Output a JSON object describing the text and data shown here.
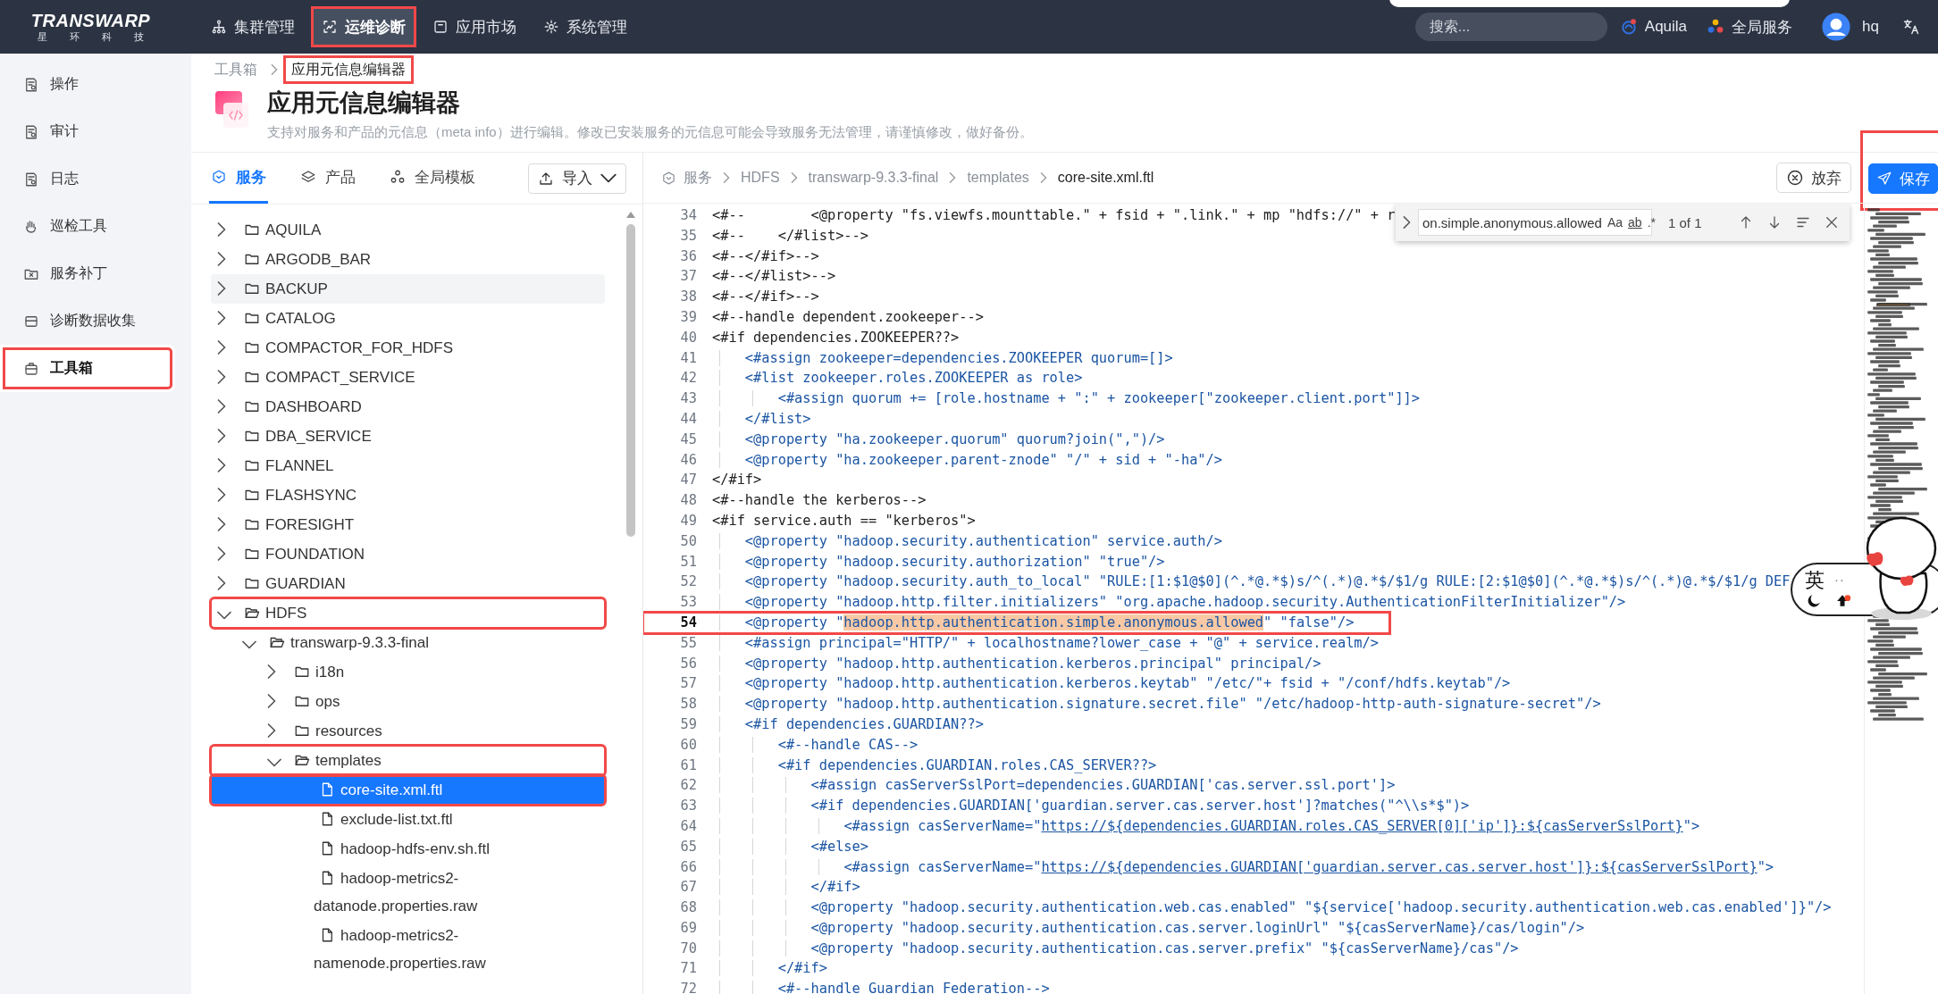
{
  "topbar": {
    "logo": {
      "name": "TRANSWARP",
      "tagline": "星 环 科 技"
    },
    "nav": [
      {
        "label": "集群管理",
        "selected": false,
        "annotated": false
      },
      {
        "label": "运维诊断",
        "selected": true,
        "annotated": true
      },
      {
        "label": "应用市场",
        "selected": false,
        "annotated": false
      },
      {
        "label": "系统管理",
        "selected": false,
        "annotated": false
      }
    ],
    "search": {
      "placeholder": "搜索..."
    },
    "links": [
      {
        "label": "Aquila"
      },
      {
        "label": "全局服务"
      }
    ],
    "user": {
      "name": "hq"
    }
  },
  "sidebar": {
    "items": [
      {
        "label": "操作",
        "selected": false,
        "annotated": false
      },
      {
        "label": "审计",
        "selected": false,
        "annotated": false
      },
      {
        "label": "日志",
        "selected": false,
        "annotated": false
      },
      {
        "label": "巡检工具",
        "selected": false,
        "annotated": false
      },
      {
        "label": "服务补丁",
        "selected": false,
        "annotated": false
      },
      {
        "label": "诊断数据收集",
        "selected": false,
        "annotated": false
      },
      {
        "label": "工具箱",
        "selected": true,
        "annotated": true
      }
    ]
  },
  "breadcrumb": [
    {
      "label": "工具箱",
      "current": false,
      "annotated": false
    },
    {
      "label": "应用元信息编辑器",
      "current": true,
      "annotated": true
    }
  ],
  "page": {
    "title": "应用元信息编辑器",
    "description": "支持对服务和产品的元信息（meta info）进行编辑。修改已安装服务的元信息可能会导致服务无法管理，请谨慎修改，做好备份。"
  },
  "tree_panel": {
    "tabs": [
      {
        "label": "服务",
        "selected": true
      },
      {
        "label": "产品",
        "selected": false
      },
      {
        "label": "全局模板",
        "selected": false
      }
    ],
    "import_button": "导入",
    "tree": [
      {
        "kind": "folder",
        "name": "AQUILA",
        "expanded": false,
        "selected": false,
        "hovered": false,
        "annotated": false
      },
      {
        "kind": "folder",
        "name": "ARGODB_BAR",
        "expanded": false,
        "selected": false,
        "hovered": false,
        "annotated": false
      },
      {
        "kind": "folder",
        "name": "BACKUP",
        "expanded": false,
        "selected": false,
        "hovered": true,
        "annotated": false
      },
      {
        "kind": "folder",
        "name": "CATALOG",
        "expanded": false,
        "selected": false,
        "hovered": false,
        "annotated": false
      },
      {
        "kind": "folder",
        "name": "COMPACTOR_FOR_HDFS",
        "expanded": false,
        "selected": false,
        "hovered": false,
        "annotated": false
      },
      {
        "kind": "folder",
        "name": "COMPACT_SERVICE",
        "expanded": false,
        "selected": false,
        "hovered": false,
        "annotated": false
      },
      {
        "kind": "folder",
        "name": "DASHBOARD",
        "expanded": false,
        "selected": false,
        "hovered": false,
        "annotated": false
      },
      {
        "kind": "folder",
        "name": "DBA_SERVICE",
        "expanded": false,
        "selected": false,
        "hovered": false,
        "annotated": false
      },
      {
        "kind": "folder",
        "name": "FLANNEL",
        "expanded": false,
        "selected": false,
        "hovered": false,
        "annotated": false
      },
      {
        "kind": "folder",
        "name": "FLASHSYNC",
        "expanded": false,
        "selected": false,
        "hovered": false,
        "annotated": false
      },
      {
        "kind": "folder",
        "name": "FORESIGHT",
        "expanded": false,
        "selected": false,
        "hovered": false,
        "annotated": false
      },
      {
        "kind": "folder",
        "name": "FOUNDATION",
        "expanded": false,
        "selected": false,
        "hovered": false,
        "annotated": false
      },
      {
        "kind": "folder",
        "name": "GUARDIAN",
        "expanded": false,
        "selected": false,
        "hovered": false,
        "annotated": false
      },
      {
        "kind": "folder",
        "name": "HDFS",
        "expanded": true,
        "selected": false,
        "hovered": false,
        "annotated": true,
        "children": [
          {
            "kind": "folder",
            "name": "transwarp-9.3.3-final",
            "expanded": true,
            "selected": false,
            "hovered": false,
            "annotated": false,
            "children": [
              {
                "kind": "folder",
                "name": "i18n",
                "expanded": false,
                "selected": false,
                "hovered": false,
                "annotated": false
              },
              {
                "kind": "folder",
                "name": "ops",
                "expanded": false,
                "selected": false,
                "hovered": false,
                "annotated": false
              },
              {
                "kind": "folder",
                "name": "resources",
                "expanded": false,
                "selected": false,
                "hovered": false,
                "annotated": false
              },
              {
                "kind": "folder",
                "name": "templates",
                "expanded": true,
                "selected": false,
                "hovered": false,
                "annotated": true,
                "children": [
                  {
                    "kind": "file",
                    "name": "core-site.xml.ftl",
                    "selected": true,
                    "hovered": false,
                    "annotated": true
                  },
                  {
                    "kind": "file",
                    "name": "exclude-list.txt.ftl",
                    "selected": false,
                    "hovered": false,
                    "annotated": false
                  },
                  {
                    "kind": "file",
                    "name": "hadoop-hdfs-env.sh.ftl",
                    "selected": false,
                    "hovered": false,
                    "annotated": false
                  },
                  {
                    "kind": "file",
                    "name": "hadoop-metrics2-datanode.properties.raw",
                    "selected": false,
                    "hovered": false,
                    "annotated": false
                  },
                  {
                    "kind": "file",
                    "name": "hadoop-metrics2-namenode.properties.raw",
                    "selected": false,
                    "hovered": false,
                    "annotated": false
                  }
                ]
              }
            ]
          }
        ]
      }
    ]
  },
  "editor": {
    "path": [
      {
        "label": "服务",
        "current": false
      },
      {
        "label": "HDFS",
        "current": false
      },
      {
        "label": "transwarp-9.3.3-final",
        "current": false
      },
      {
        "label": "templates",
        "current": false
      },
      {
        "label": "core-site.xml.ftl",
        "current": true
      }
    ],
    "discard_button": "放弃",
    "save_button": {
      "label": "保存",
      "annotated": true
    },
    "find": {
      "value": "on.simple.anonymous.allowed",
      "options": [
        "Aa",
        "ab",
        ".*"
      ],
      "count": "1 of 1"
    },
    "lines": [
      {
        "number": "34",
        "current": false,
        "annotated": false,
        "text": "<#--        <@property \"fs.viewfs.mounttable.\" + fsid + \".link.\" + mp \"hdfs://\" + r"
      },
      {
        "number": "35",
        "current": false,
        "annotated": false,
        "text": "<#--    </#list>-->"
      },
      {
        "number": "36",
        "current": false,
        "annotated": false,
        "text": "<#--</#if>-->"
      },
      {
        "number": "37",
        "current": false,
        "annotated": false,
        "text": "<#--</#list>-->"
      },
      {
        "number": "38",
        "current": false,
        "annotated": false,
        "text": "<#--</#if>-->"
      },
      {
        "number": "39",
        "current": false,
        "annotated": false,
        "text": "<#--handle dependent.zookeeper-->"
      },
      {
        "number": "40",
        "current": false,
        "annotated": false,
        "text": "<#if dependencies.ZOOKEEPER??>"
      },
      {
        "number": "41",
        "current": false,
        "annotated": false,
        "text": "    <#assign zookeeper=dependencies.ZOOKEEPER quorum=[]>"
      },
      {
        "number": "42",
        "current": false,
        "annotated": false,
        "text": "    <#list zookeeper.roles.ZOOKEEPER as role>"
      },
      {
        "number": "43",
        "current": false,
        "annotated": false,
        "text": "        <#assign quorum += [role.hostname + \":\" + zookeeper[\"zookeeper.client.port\"]]>"
      },
      {
        "number": "44",
        "current": false,
        "annotated": false,
        "text": "    </#list>"
      },
      {
        "number": "45",
        "current": false,
        "annotated": false,
        "text": "    <@property \"ha.zookeeper.quorum\" quorum?join(\",\")/>"
      },
      {
        "number": "46",
        "current": false,
        "annotated": false,
        "text": "    <@property \"ha.zookeeper.parent-znode\" \"/\" + sid + \"-ha\"/>"
      },
      {
        "number": "47",
        "current": false,
        "annotated": false,
        "text": "</#if>"
      },
      {
        "number": "48",
        "current": false,
        "annotated": false,
        "text": "<#--handle the kerberos-->"
      },
      {
        "number": "49",
        "current": false,
        "annotated": false,
        "text": "<#if service.auth == \"kerberos\">"
      },
      {
        "number": "50",
        "current": false,
        "annotated": false,
        "text": "    <@property \"hadoop.security.authentication\" service.auth/>"
      },
      {
        "number": "51",
        "current": false,
        "annotated": false,
        "text": "    <@property \"hadoop.security.authorization\" \"true\"/>"
      },
      {
        "number": "52",
        "current": false,
        "annotated": false,
        "text": "    <@property \"hadoop.security.auth_to_local\" \"RULE:[1:$1@$0](^.*@.*$)s/^(.*)@.*$/$1/g RULE:[2:$1@$0](^.*@.*$)s/^(.*)@.*$/$1/g DEF"
      },
      {
        "number": "53",
        "current": false,
        "annotated": false,
        "text": "    <@property \"hadoop.http.filter.initializers\" \"org.apache.hadoop.security.AuthenticationFilterInitializer\"/>"
      },
      {
        "number": "54",
        "current": true,
        "annotated": true,
        "segments": [
          {
            "kind": "code",
            "text": "    <@property \""
          },
          {
            "kind": "match",
            "text": "hadoop.http.authentication.simple.anonymous.allowed"
          },
          {
            "kind": "code",
            "text": "\" \"false\"/>"
          }
        ]
      },
      {
        "number": "55",
        "current": false,
        "annotated": false,
        "text": "    <#assign principal=\"HTTP/\" + localhostname?lower_case + \"@\" + service.realm/>"
      },
      {
        "number": "56",
        "current": false,
        "annotated": false,
        "text": "    <@property \"hadoop.http.authentication.kerberos.principal\" principal/>"
      },
      {
        "number": "57",
        "current": false,
        "annotated": false,
        "text": "    <@property \"hadoop.http.authentication.kerberos.keytab\" \"/etc/\"+ fsid + \"/conf/hdfs.keytab\"/>"
      },
      {
        "number": "58",
        "current": false,
        "annotated": false,
        "text": "    <@property \"hadoop.http.authentication.signature.secret.file\" \"/etc/hadoop-http-auth-signature-secret\"/>"
      },
      {
        "number": "59",
        "current": false,
        "annotated": false,
        "text": "    <#if dependencies.GUARDIAN??>"
      },
      {
        "number": "60",
        "current": false,
        "annotated": false,
        "text": "        <#--handle CAS-->"
      },
      {
        "number": "61",
        "current": false,
        "annotated": false,
        "text": "        <#if dependencies.GUARDIAN.roles.CAS_SERVER??>"
      },
      {
        "number": "62",
        "current": false,
        "annotated": false,
        "text": "            <#assign casServerSslPort=dependencies.GUARDIAN['cas.server.ssl.port']>"
      },
      {
        "number": "63",
        "current": false,
        "annotated": false,
        "text": "            <#if dependencies.GUARDIAN['guardian.server.cas.server.host']?matches(\"^\\\\s*$\")>"
      },
      {
        "number": "64",
        "current": false,
        "annotated": false,
        "segments": [
          {
            "kind": "code",
            "text": "                <#assign casServerName=\""
          },
          {
            "kind": "link",
            "text": "https://${dependencies.GUARDIAN.roles.CAS_SERVER[0]['ip']}:${casServerSslPort}"
          },
          {
            "kind": "code",
            "text": "\">"
          }
        ]
      },
      {
        "number": "65",
        "current": false,
        "annotated": false,
        "text": "            <#else>"
      },
      {
        "number": "66",
        "current": false,
        "annotated": false,
        "segments": [
          {
            "kind": "code",
            "text": "                <#assign casServerName=\""
          },
          {
            "kind": "link",
            "text": "https://${dependencies.GUARDIAN['guardian.server.cas.server.host']}:${casServerSslPort}"
          },
          {
            "kind": "code",
            "text": "\">"
          }
        ]
      },
      {
        "number": "67",
        "current": false,
        "annotated": false,
        "text": "            </#if>"
      },
      {
        "number": "68",
        "current": false,
        "annotated": false,
        "text": "            <@property \"hadoop.security.authentication.web.cas.enabled\" \"${service['hadoop.security.authentication.web.cas.enabled']}\"/>"
      },
      {
        "number": "69",
        "current": false,
        "annotated": false,
        "text": "            <@property \"hadoop.security.authentication.cas.server.loginUrl\" \"${casServerName}/cas/login\"/>"
      },
      {
        "number": "70",
        "current": false,
        "annotated": false,
        "text": "            <@property \"hadoop.security.authentication.cas.server.prefix\" \"${casServerName}/cas\"/>"
      },
      {
        "number": "71",
        "current": false,
        "annotated": false,
        "text": "        </#if>"
      },
      {
        "number": "72",
        "current": false,
        "annotated": false,
        "text": "        <#--handle Guardian Federation-->"
      }
    ]
  },
  "ime": {
    "label": "英"
  }
}
